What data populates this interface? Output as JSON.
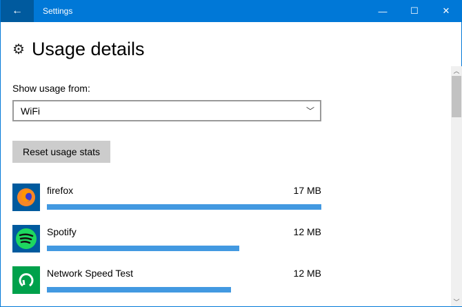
{
  "window": {
    "title": "Settings",
    "back": "←",
    "minimize": "—",
    "maximize": "☐",
    "close": "✕"
  },
  "page": {
    "title": "Usage details",
    "icon": "⚙"
  },
  "usage_from": {
    "label": "Show usage from:",
    "value": "WiFi",
    "chevron": "﹀"
  },
  "reset_label": "Reset usage stats",
  "scroll": {
    "up": "︿",
    "down": "﹀"
  },
  "apps": [
    {
      "name": "firefox",
      "size": "17 MB",
      "fraction": 1.0
    },
    {
      "name": "Spotify",
      "size": "12 MB",
      "fraction": 0.7
    },
    {
      "name": "Network Speed Test",
      "size": "12 MB",
      "fraction": 0.67
    }
  ]
}
